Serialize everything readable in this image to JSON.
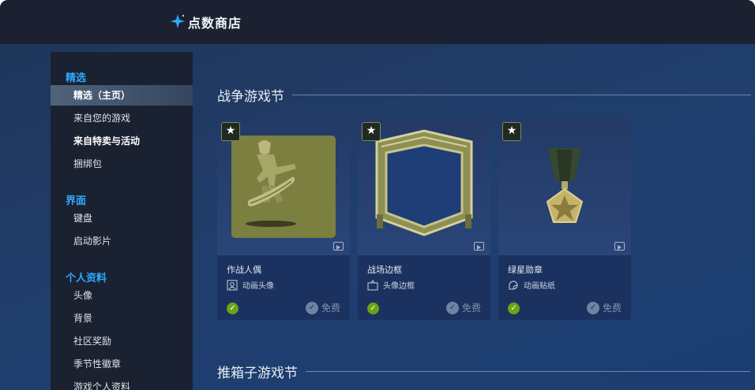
{
  "header": {
    "title": "点数商店",
    "logo_icon": "sparkle-icon"
  },
  "sidebar": {
    "sections": [
      {
        "title": "精选",
        "items": [
          {
            "label": "精选（主页）",
            "active": true
          },
          {
            "label": "来自您的游戏"
          },
          {
            "label": "来自特卖与活动",
            "bold": true
          },
          {
            "label": "捆绑包"
          }
        ]
      },
      {
        "title": "界面",
        "items": [
          {
            "label": "键盘"
          },
          {
            "label": "启动影片"
          }
        ]
      },
      {
        "title": "个人资料",
        "items": [
          {
            "label": "头像"
          },
          {
            "label": "背景"
          },
          {
            "label": "社区奖励"
          },
          {
            "label": "季节性徽章"
          },
          {
            "label": "游戏个人资料"
          }
        ]
      }
    ]
  },
  "main": {
    "sections": [
      {
        "title": "战争游戏节"
      },
      {
        "title": "推箱子游戏节"
      }
    ],
    "cards": [
      {
        "name": "作战人偶",
        "type_label": "动画头像",
        "type_icon": "avatar-icon",
        "price_label": "免费",
        "art": "soldier-figure"
      },
      {
        "name": "战场边框",
        "type_label": "头像边框",
        "type_icon": "frame-icon",
        "price_label": "免费",
        "art": "battlefield-frame"
      },
      {
        "name": "绿星勋章",
        "type_label": "动画贴纸",
        "type_icon": "sticker-icon",
        "price_label": "免费",
        "art": "green-star-medal"
      }
    ]
  },
  "colors": {
    "accent": "#2fa9ff",
    "owned_green": "#6aa315",
    "sidebar_bg": "#1a2130",
    "topbar_bg": "#1b2130"
  }
}
